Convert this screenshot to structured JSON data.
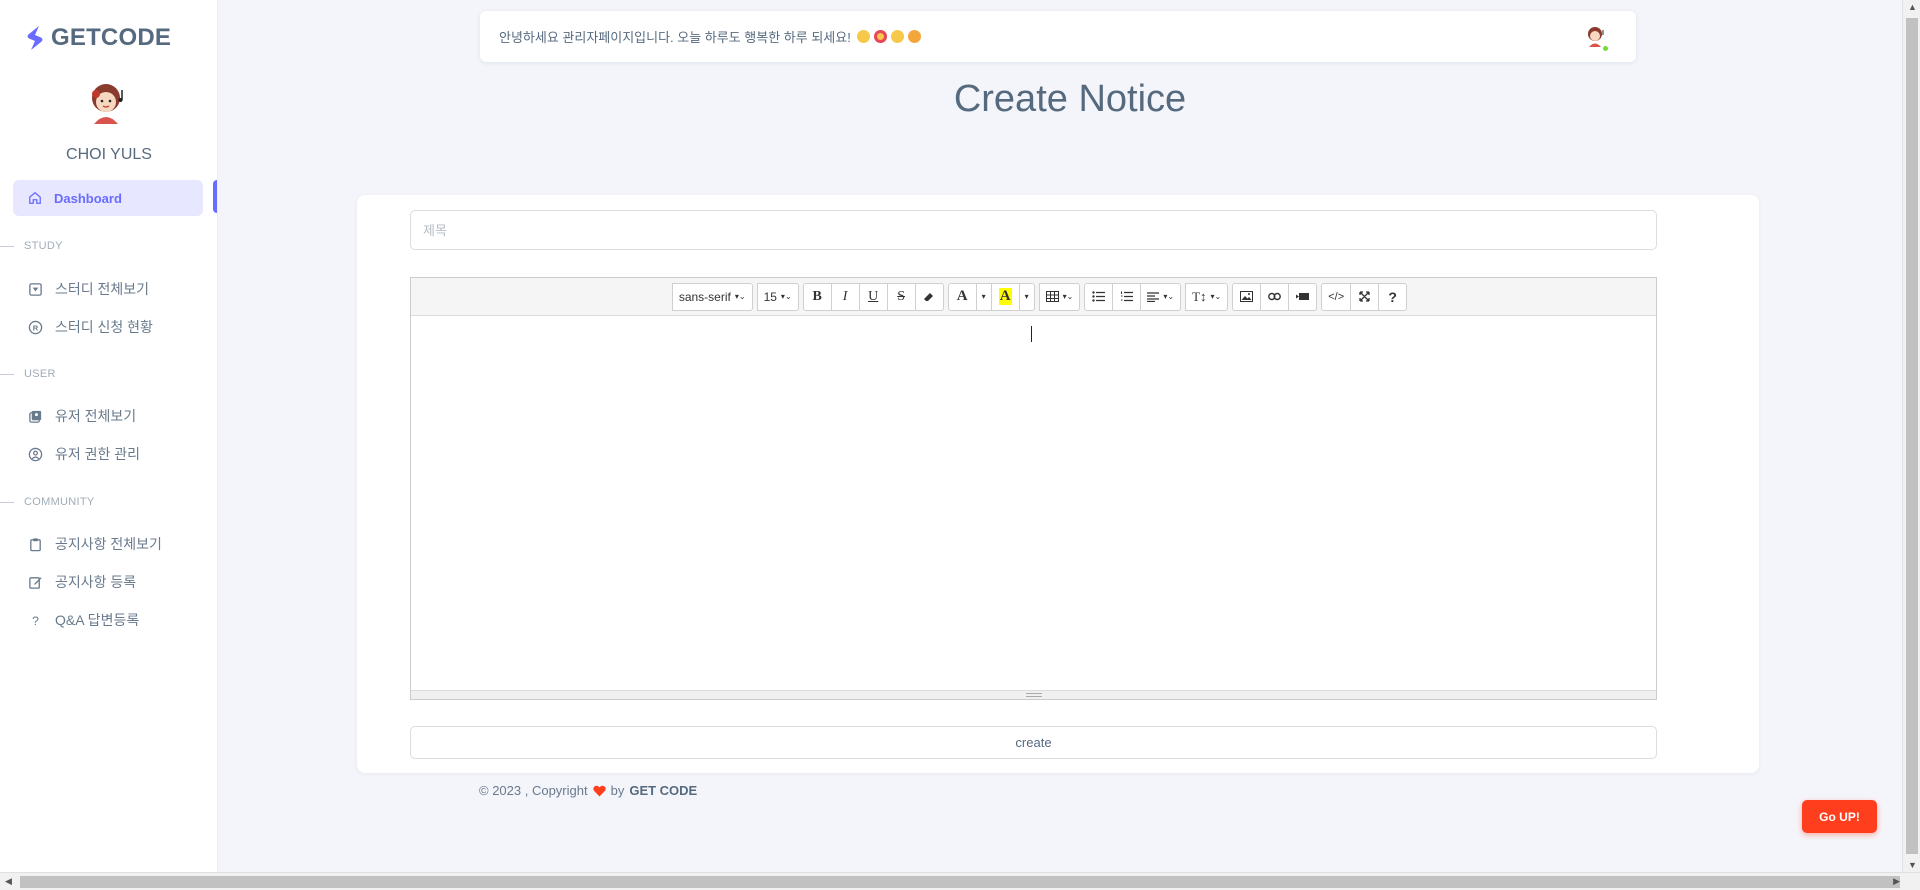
{
  "brand": {
    "name": "GETCODE"
  },
  "user": {
    "name": "CHOI YULS"
  },
  "sidebar": {
    "active": {
      "label": "Dashboard",
      "icon": "home-icon"
    },
    "sections": [
      {
        "title": "STUDY",
        "items": [
          {
            "label": "스터디 전체보기",
            "icon": "study-list-icon"
          },
          {
            "label": "스터디 신청 현황",
            "icon": "registered-icon"
          }
        ]
      },
      {
        "title": "USER",
        "items": [
          {
            "label": "유저 전체보기",
            "icon": "users-list-icon"
          },
          {
            "label": "유저 권한 관리",
            "icon": "user-circle-icon"
          }
        ]
      },
      {
        "title": "COMMUNITY",
        "items": [
          {
            "label": "공지사항 전체보기",
            "icon": "clipboard-icon"
          },
          {
            "label": "공지사항 등록",
            "icon": "edit-icon"
          },
          {
            "label": "Q&A 답변등록",
            "icon": "question-icon"
          }
        ]
      }
    ]
  },
  "topbar": {
    "greeting": "안녕하세요 관리자페이지입니다. 오늘 하루도 행복한 하루 되세요!"
  },
  "page": {
    "title": "Create Notice"
  },
  "form": {
    "title_placeholder": "제목",
    "create_label": "create"
  },
  "editor": {
    "font_family": "sans-serif",
    "font_size": "15",
    "bold": "B",
    "italic": "I",
    "underline": "U",
    "strike": "S",
    "help": "?",
    "code": "</>"
  },
  "footer": {
    "prefix": "© 2023 , Copyright",
    "by": "by",
    "owner": "GET CODE"
  },
  "goup": {
    "label": "Go UP!"
  },
  "colors": {
    "accent": "#696cff",
    "danger": "#ff3e1d",
    "online": "#71dd37"
  }
}
